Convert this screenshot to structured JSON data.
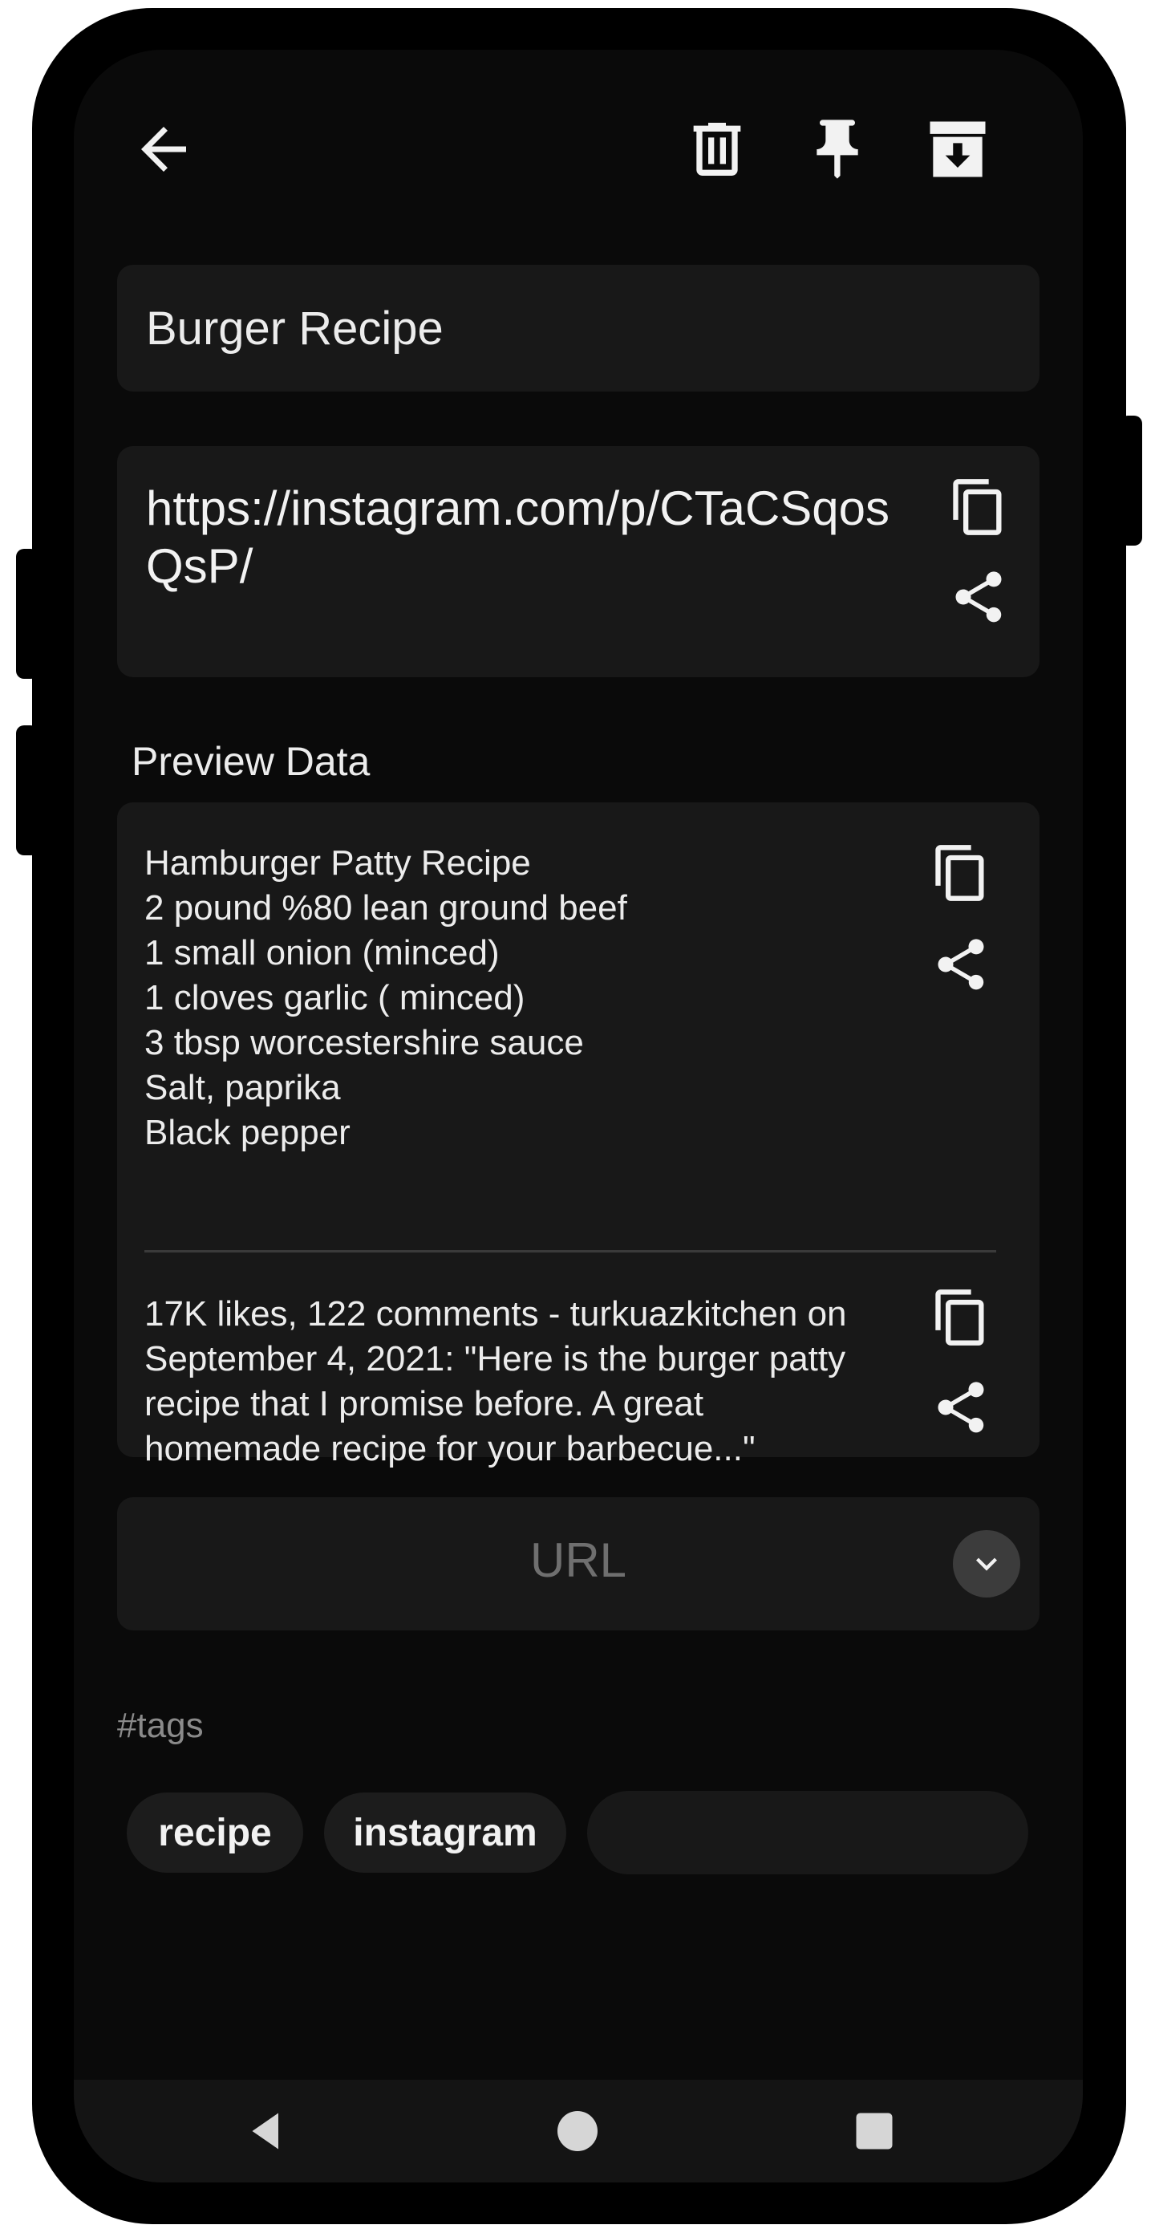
{
  "toolbar": {
    "back_icon": "arrow-left-icon",
    "delete_icon": "trash-icon",
    "pin_icon": "pin-icon",
    "archive_icon": "archive-icon"
  },
  "note": {
    "title": "Burger Recipe",
    "url": "https://instagram.com/p/CTaCSqosQsP/"
  },
  "preview": {
    "section_label": "Preview Data",
    "title_block": "Hamburger Patty Recipe\n2 pound %80 lean  ground beef\n1 small onion (minced)\n1 cloves garlic ( minced)\n3 tbsp worcestershire sauce\nSalt,  paprika\nBlack pepper",
    "description_block": "17K likes, 122 comments - turkuazkitchen on September 4, 2021: \"Here is the burger patty recipe that I promise before.  A great homemade recipe for your barbecue...\""
  },
  "type_select": {
    "value": "URL"
  },
  "tags": {
    "label": "#tags",
    "items": [
      "recipe",
      "instagram"
    ],
    "input_value": ""
  },
  "colors": {
    "background": "#0a0a0a",
    "card": "#181818",
    "text": "#ececec",
    "muted": "#6f6f6f"
  }
}
